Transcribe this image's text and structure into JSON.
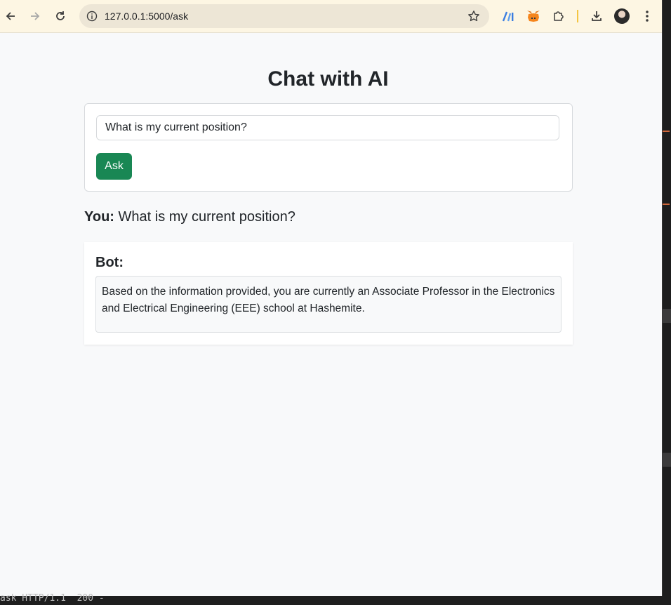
{
  "browser": {
    "url": "127.0.0.1:5000/ask",
    "icons": [
      "back-arrow-icon",
      "forward-arrow-icon",
      "reload-icon",
      "info-icon",
      "bookmark-star-icon",
      "ai-extension-icon",
      "metamask-fox-icon",
      "puzzle-extensions-icon",
      "download-icon",
      "profile-avatar",
      "more-vert-icon"
    ]
  },
  "page": {
    "title": "Chat with AI",
    "input_value": "What is my current position?",
    "ask_label": "Ask",
    "you_label": "You:",
    "you_message": "What is my current position?",
    "bot_label": "Bot:",
    "bot_answer": "Based on the information provided, you are currently an Associate Professor in the Electronics and Electrical Engineering (EEE) school at Hashemite."
  },
  "terminal": {
    "bottom_text": "ask HTTP/1.1  200 -"
  },
  "colors": {
    "accent_button": "#198754",
    "toolbar": "#fdf6e3",
    "page_bg": "#f8f9fa"
  }
}
